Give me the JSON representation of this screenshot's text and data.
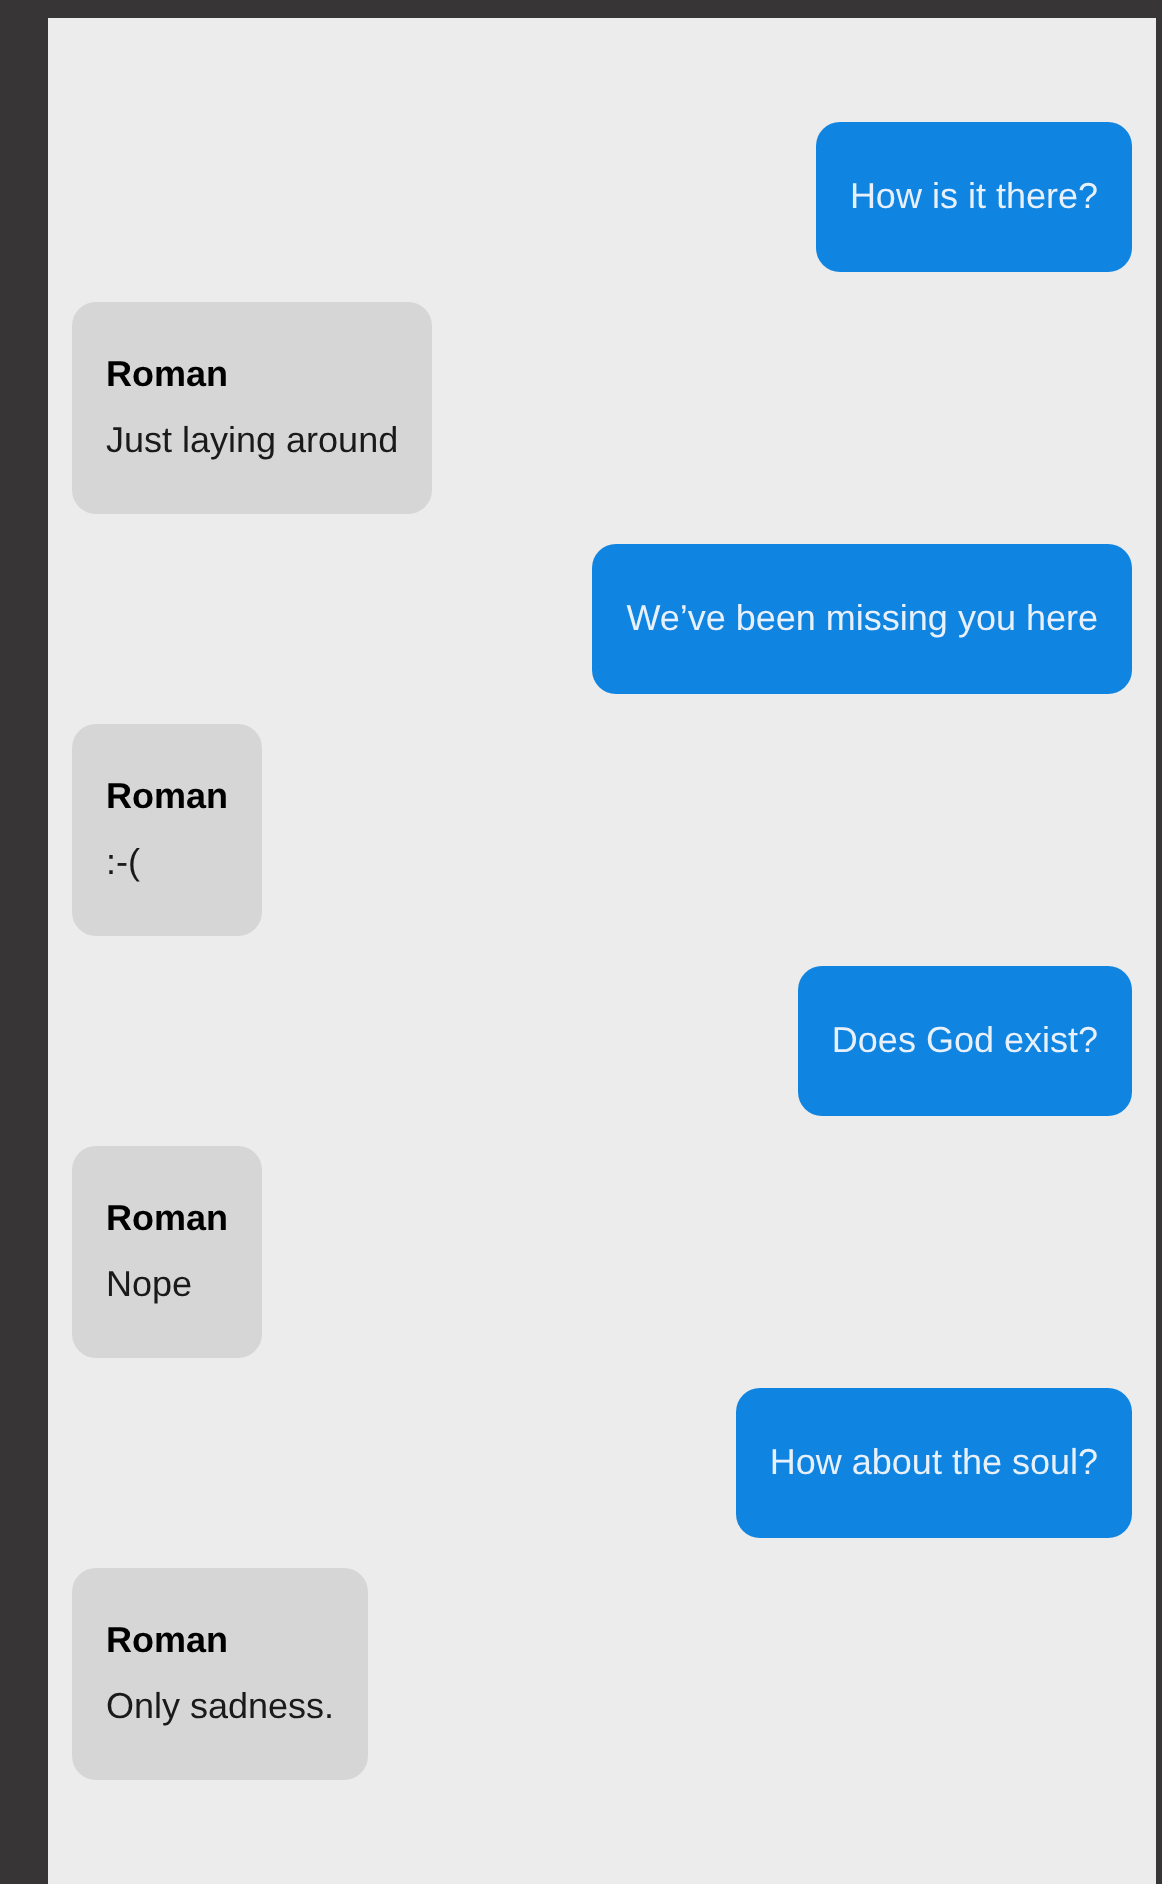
{
  "messages": [
    {
      "kind": "sent",
      "text": "How is it there?"
    },
    {
      "kind": "received",
      "sender": "Roman",
      "text": "Just laying around"
    },
    {
      "kind": "sent",
      "text": "We’ve been missing you here"
    },
    {
      "kind": "received",
      "sender": "Roman",
      "text": ":-("
    },
    {
      "kind": "sent",
      "text": "Does God exist?"
    },
    {
      "kind": "received",
      "sender": "Roman",
      "text": "Nope"
    },
    {
      "kind": "sent",
      "text": "How about the soul?"
    },
    {
      "kind": "received",
      "sender": "Roman",
      "text": "Only sadness."
    }
  ]
}
